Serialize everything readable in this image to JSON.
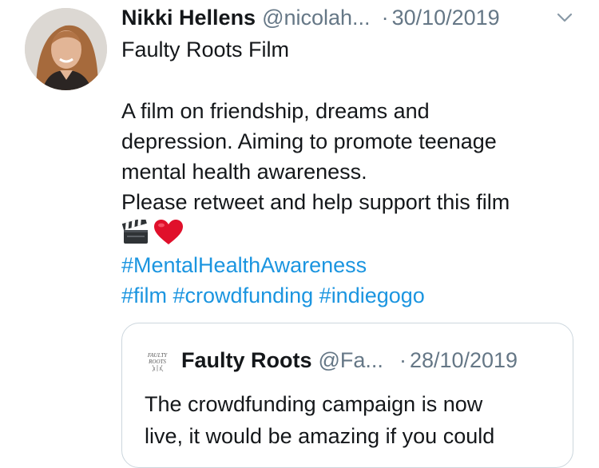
{
  "tweet": {
    "author_name": "Nikki Hellens",
    "handle": "@nicolah...",
    "dot": "·",
    "date": "30/10/2019",
    "title": "Faulty Roots Film",
    "body_lines": [
      "A film on friendship, dreams and",
      "depression. Aiming to promote teenage",
      "mental health awareness.",
      "Please retweet and help support this film"
    ],
    "emojis": [
      "clapper-board-emoji",
      "red-heart-emoji"
    ],
    "hashtags": [
      "#MentalHealthAwareness",
      "#film",
      "#crowdfunding",
      "#indiegogo"
    ]
  },
  "quoted_tweet": {
    "logo_text": "FAULTY ROOTS",
    "author_name": "Faulty Roots",
    "handle": "@Fa...",
    "dot": "·",
    "date": "28/10/2019",
    "text_lines": [
      "The crowdfunding campaign is now",
      "live, it would be amazing if you could"
    ]
  },
  "colors": {
    "link": "#1b95e0",
    "secondary_text": "#657786",
    "border": "#ccd6dd"
  }
}
